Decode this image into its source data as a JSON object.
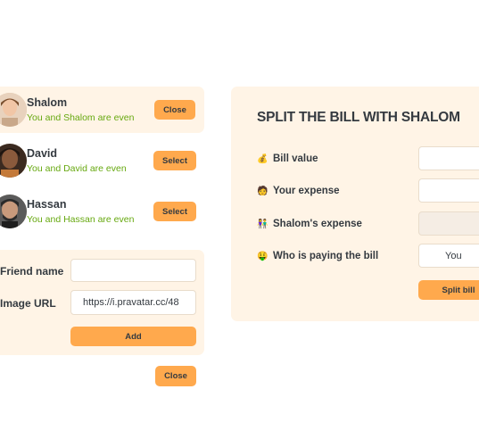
{
  "friends": [
    {
      "name": "Shalom",
      "status": "You and Shalom are even",
      "button": "Close",
      "selected": true
    },
    {
      "name": "David",
      "status": "You and David are even",
      "button": "Select",
      "selected": false
    },
    {
      "name": "Hassan",
      "status": "You and Hassan are even",
      "button": "Select",
      "selected": false
    }
  ],
  "add_form": {
    "friend_name_label": "Friend name",
    "friend_name_value": "",
    "image_url_label": "Image URL",
    "image_url_value": "https://i.pravatar.cc/48",
    "add_label": "Add"
  },
  "close_button_label": "Close",
  "split": {
    "title": "SPLIT THE BILL WITH SHALOM",
    "bill_value_icon": "💰",
    "bill_value_label": "Bill value",
    "your_expense_icon": "🧑",
    "your_expense_label": "Your expense",
    "friend_expense_icon": "👫",
    "friend_expense_label": "Shalom's expense",
    "payer_icon": "🤑",
    "payer_label": "Who is paying the bill",
    "payer_value": "You",
    "submit_label": "Split bill"
  },
  "colors": {
    "accent": "#ffa94d",
    "panel_bg": "#fff4e6",
    "even_text": "#66a80f"
  }
}
